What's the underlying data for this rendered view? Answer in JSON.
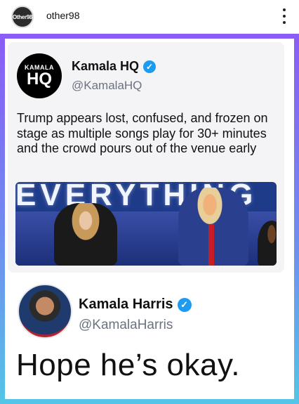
{
  "post": {
    "avatar_text": "Other98",
    "username": "other98"
  },
  "embedded_tweet": {
    "avatar_line1": "KAMALA",
    "avatar_line2": "HQ",
    "name": "Kamala HQ",
    "handle": "@KamalaHQ",
    "text": "Trump appears lost, confused, and frozen on stage as multiple songs play for 30+ minutes and the crowd pours out of the venue early",
    "photo_banner_text": "EVERYTHING"
  },
  "reply": {
    "name": "Kamala Harris",
    "handle": "@KamalaHarris",
    "text": "Hope he’s okay."
  },
  "colors": {
    "verified": "#1d9bf0",
    "frame_gradient_top": "#8b5cf6",
    "frame_gradient_bottom": "#54c5e6"
  }
}
